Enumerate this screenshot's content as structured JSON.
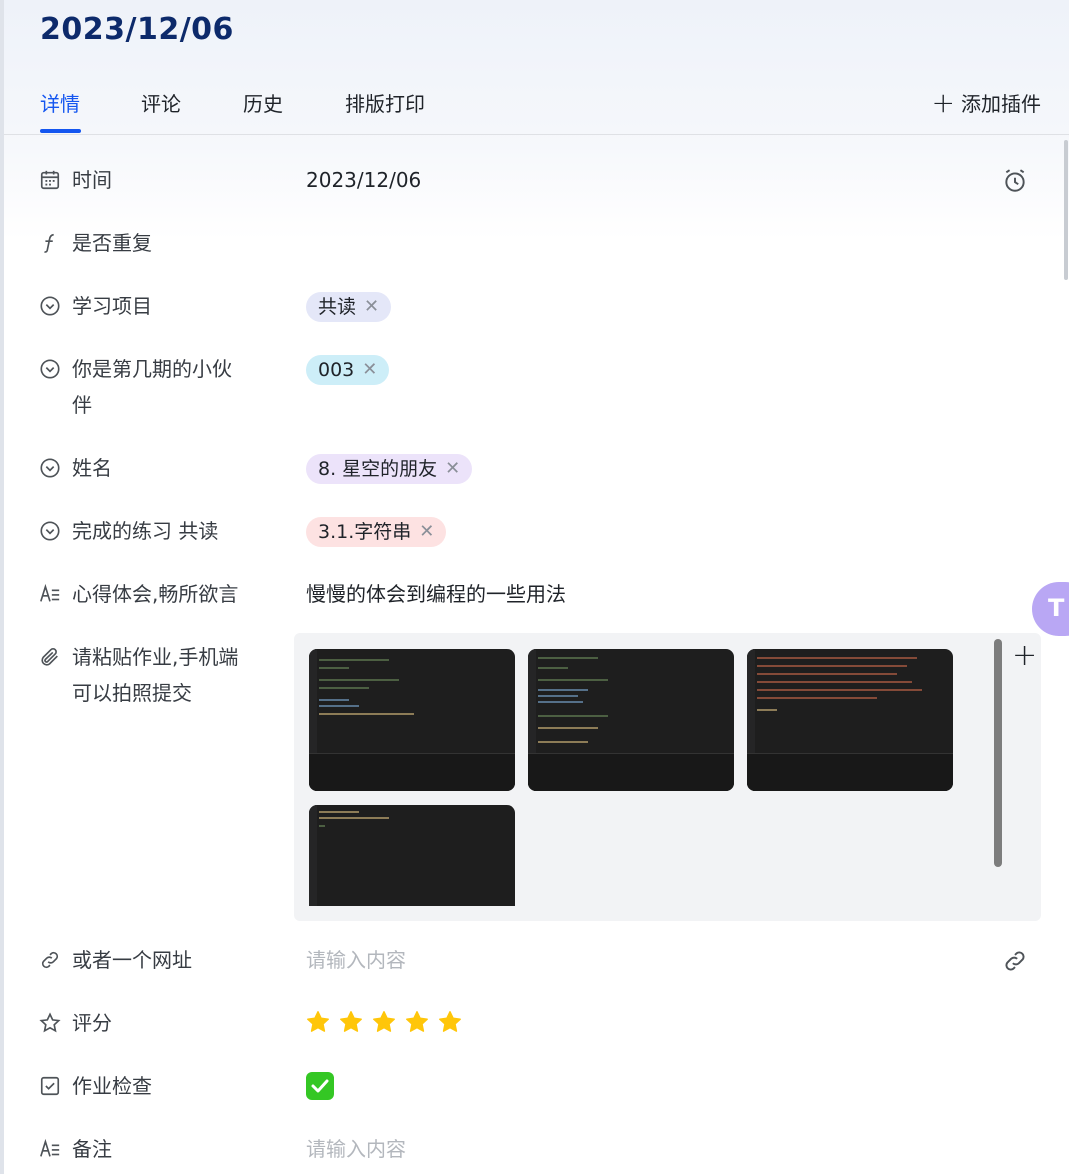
{
  "record": {
    "title": "2023/12/06"
  },
  "tabs": [
    {
      "label": "详情",
      "active": true
    },
    {
      "label": "评论",
      "active": false
    },
    {
      "label": "历史",
      "active": false
    },
    {
      "label": "排版打印",
      "active": false
    }
  ],
  "toolbar": {
    "add_plugin_label": "添加插件"
  },
  "fields": {
    "time": {
      "label": "时间",
      "value": "2023/12/06",
      "icon": "calendar-icon",
      "action_icon": "alarm-clock-icon"
    },
    "repeat": {
      "label": "是否重复",
      "icon": "formula-icon"
    },
    "project": {
      "label": "学习项目",
      "icon": "single-select-icon",
      "tags": [
        "共读"
      ]
    },
    "cohort": {
      "label": "你是第几期的小伙伴",
      "label_line2": "伴",
      "label_line1": "你是第几期的小伙",
      "icon": "single-select-icon",
      "tags": [
        "003"
      ]
    },
    "name": {
      "label": "姓名",
      "icon": "single-select-icon",
      "tags": [
        "8. 星空的朋友"
      ]
    },
    "exercise": {
      "label": "完成的练习 共读",
      "icon": "single-select-icon",
      "tags": [
        "3.1.字符串"
      ]
    },
    "reflection": {
      "label": "心得体会,畅所欲言",
      "icon": "text-icon",
      "value": "慢慢的体会到编程的一些用法"
    },
    "attachment": {
      "label_line1": "请粘贴作业,手机端",
      "label_line2": "可以拍照提交",
      "icon": "paperclip-icon",
      "add_icon": "plus-icon"
    },
    "url": {
      "label": "或者一个网址",
      "icon": "link-icon",
      "placeholder": "请输入内容",
      "action_icon": "link-icon"
    },
    "rating": {
      "label": "评分",
      "icon": "star-outline-icon",
      "value": 5,
      "max": 5
    },
    "homework_check": {
      "label": "作业检查",
      "icon": "checkbox-icon",
      "checked": true
    },
    "notes": {
      "label": "备注",
      "icon": "text-icon",
      "placeholder": "请输入内容"
    }
  },
  "colors": {
    "accent": "#1456f0",
    "title": "#0d2a6b",
    "star": "#ffc60a",
    "check": "#34c724"
  }
}
